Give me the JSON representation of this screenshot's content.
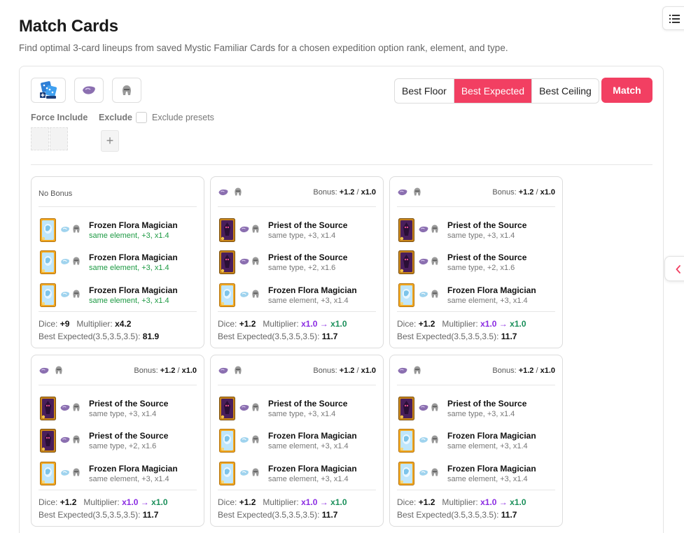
{
  "page": {
    "title": "Match Cards",
    "subtitle": "Find optimal 3-card lineups from saved Mystic Familiar Cards for a chosen expedition option rank, element, and type."
  },
  "controls": {
    "option_icons": [
      "dice-rank-icon",
      "spirit-element-icon",
      "helmet-type-icon"
    ],
    "force_include_label": "Force Include",
    "exclude_label": "Exclude",
    "exclude_presets_label": "Exclude presets",
    "exclude_presets_checked": false,
    "add_symbol": "+",
    "modes": [
      "Best Floor",
      "Best Expected",
      "Best Ceiling"
    ],
    "active_mode": "Best Expected",
    "match_label": "Match"
  },
  "colors": {
    "accent": "#f23f62",
    "green": "#1e9a44",
    "purple": "#8a2be2",
    "teal": "#1a8f5a"
  },
  "results": [
    {
      "header_type": "no-bonus",
      "no_bonus_label": "No Bonus",
      "cards": [
        {
          "name": "Frozen Flora Magician",
          "detail": "same element, +3, x1.4",
          "kind": "frozen",
          "highlight": true
        },
        {
          "name": "Frozen Flora Magician",
          "detail": "same element, +3, x1.4",
          "kind": "frozen",
          "highlight": true
        },
        {
          "name": "Frozen Flora Magician",
          "detail": "same element, +3, x1.4",
          "kind": "frozen",
          "highlight": true
        }
      ],
      "dice_label": "Dice:",
      "dice": "+9",
      "mult_label": "Multiplier:",
      "mult_plain": "x4.2",
      "mult_from": "",
      "mult_to": "",
      "be_label": "Best Expected(3.5,3.5,3.5):",
      "be_value": "81.9"
    },
    {
      "header_type": "bonus",
      "bonus_label": "Bonus:",
      "bonus_dice": "+1.2",
      "bonus_mult": "x1.0",
      "cards": [
        {
          "name": "Priest of the Source",
          "detail": "same type, +3, x1.4",
          "kind": "priest",
          "highlight": false
        },
        {
          "name": "Priest of the Source",
          "detail": "same type, +2, x1.6",
          "kind": "priest",
          "highlight": false
        },
        {
          "name": "Frozen Flora Magician",
          "detail": "same element, +3, x1.4",
          "kind": "frozen",
          "highlight": false
        }
      ],
      "dice_label": "Dice:",
      "dice": "+1.2",
      "mult_label": "Multiplier:",
      "mult_plain": "",
      "mult_from": "x1.0",
      "mult_to": "x1.0",
      "be_label": "Best Expected(3.5,3.5,3.5):",
      "be_value": "11.7"
    },
    {
      "header_type": "bonus",
      "bonus_label": "Bonus:",
      "bonus_dice": "+1.2",
      "bonus_mult": "x1.0",
      "cards": [
        {
          "name": "Priest of the Source",
          "detail": "same type, +3, x1.4",
          "kind": "priest",
          "highlight": false
        },
        {
          "name": "Priest of the Source",
          "detail": "same type, +2, x1.6",
          "kind": "priest",
          "highlight": false
        },
        {
          "name": "Frozen Flora Magician",
          "detail": "same element, +3, x1.4",
          "kind": "frozen",
          "highlight": false
        }
      ],
      "dice_label": "Dice:",
      "dice": "+1.2",
      "mult_label": "Multiplier:",
      "mult_plain": "",
      "mult_from": "x1.0",
      "mult_to": "x1.0",
      "be_label": "Best Expected(3.5,3.5,3.5):",
      "be_value": "11.7"
    },
    {
      "header_type": "bonus",
      "bonus_label": "Bonus:",
      "bonus_dice": "+1.2",
      "bonus_mult": "x1.0",
      "cards": [
        {
          "name": "Priest of the Source",
          "detail": "same type, +3, x1.4",
          "kind": "priest",
          "highlight": false
        },
        {
          "name": "Priest of the Source",
          "detail": "same type, +2, x1.6",
          "kind": "priest",
          "highlight": false
        },
        {
          "name": "Frozen Flora Magician",
          "detail": "same element, +3, x1.4",
          "kind": "frozen",
          "highlight": false
        }
      ],
      "dice_label": "Dice:",
      "dice": "+1.2",
      "mult_label": "Multiplier:",
      "mult_plain": "",
      "mult_from": "x1.0",
      "mult_to": "x1.0",
      "be_label": "Best Expected(3.5,3.5,3.5):",
      "be_value": "11.7"
    },
    {
      "header_type": "bonus",
      "bonus_label": "Bonus:",
      "bonus_dice": "+1.2",
      "bonus_mult": "x1.0",
      "cards": [
        {
          "name": "Priest of the Source",
          "detail": "same type, +3, x1.4",
          "kind": "priest",
          "highlight": false
        },
        {
          "name": "Frozen Flora Magician",
          "detail": "same element, +3, x1.4",
          "kind": "frozen",
          "highlight": false
        },
        {
          "name": "Frozen Flora Magician",
          "detail": "same element, +3, x1.4",
          "kind": "frozen",
          "highlight": false
        }
      ],
      "dice_label": "Dice:",
      "dice": "+1.2",
      "mult_label": "Multiplier:",
      "mult_plain": "",
      "mult_from": "x1.0",
      "mult_to": "x1.0",
      "be_label": "Best Expected(3.5,3.5,3.5):",
      "be_value": "11.7"
    },
    {
      "header_type": "bonus",
      "bonus_label": "Bonus:",
      "bonus_dice": "+1.2",
      "bonus_mult": "x1.0",
      "cards": [
        {
          "name": "Priest of the Source",
          "detail": "same type, +3, x1.4",
          "kind": "priest",
          "highlight": false
        },
        {
          "name": "Frozen Flora Magician",
          "detail": "same element, +3, x1.4",
          "kind": "frozen",
          "highlight": false
        },
        {
          "name": "Frozen Flora Magician",
          "detail": "same element, +3, x1.4",
          "kind": "frozen",
          "highlight": false
        }
      ],
      "dice_label": "Dice:",
      "dice": "+1.2",
      "mult_label": "Multiplier:",
      "mult_plain": "",
      "mult_from": "x1.0",
      "mult_to": "x1.0",
      "be_label": "Best Expected(3.5,3.5,3.5):",
      "be_value": "11.7"
    }
  ]
}
